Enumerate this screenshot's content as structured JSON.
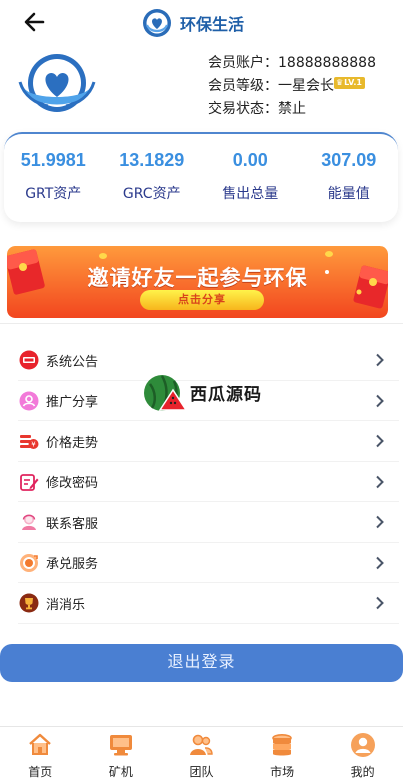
{
  "header": {
    "title": "环保生活"
  },
  "member": {
    "account_label": "会员账户：",
    "account_value": "18888888888",
    "level_label": "会员等级：",
    "level_value": "一星会长",
    "level_badge": "LV.1",
    "status_label": "交易状态：",
    "status_value": "禁止"
  },
  "stats": [
    {
      "value": "51.9981",
      "label": "GRT资产"
    },
    {
      "value": "13.1829",
      "label": "GRC资产"
    },
    {
      "value": "0.00",
      "label": "售出总量"
    },
    {
      "value": "307.09",
      "label": "能量值"
    }
  ],
  "banner": {
    "title": "邀请好友一起参与环保",
    "cta": "点击分享"
  },
  "menu": [
    {
      "label": "系统公告",
      "icon": "announcement-icon"
    },
    {
      "label": "推广分享",
      "icon": "share-icon"
    },
    {
      "label": "价格走势",
      "icon": "price-trend-icon"
    },
    {
      "label": "修改密码",
      "icon": "edit-password-icon"
    },
    {
      "label": "联系客服",
      "icon": "customer-service-icon"
    },
    {
      "label": "承兑服务",
      "icon": "exchange-service-icon"
    },
    {
      "label": "消消乐",
      "icon": "trophy-icon"
    }
  ],
  "watermark": {
    "text": "西瓜源码"
  },
  "logout": {
    "label": "退出登录"
  },
  "tabbar": [
    {
      "label": "首页",
      "icon": "home-icon"
    },
    {
      "label": "矿机",
      "icon": "miner-icon"
    },
    {
      "label": "团队",
      "icon": "team-icon"
    },
    {
      "label": "市场",
      "icon": "market-icon"
    },
    {
      "label": "我的",
      "icon": "profile-icon"
    }
  ],
  "colors": {
    "brand_blue": "#1f5fa8",
    "stat_value": "#3a8fe0",
    "stat_label": "#2b3a8c",
    "logout_button": "#4a7fd2",
    "tab_icon": "#f08a3c"
  }
}
